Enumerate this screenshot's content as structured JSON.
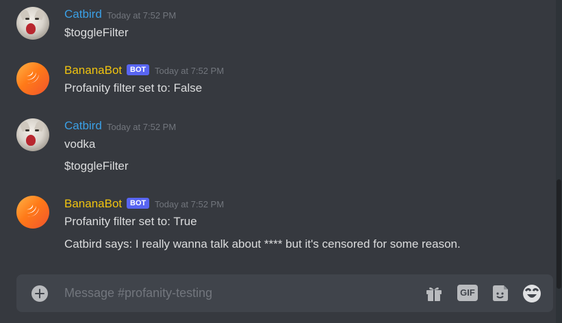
{
  "messages": [
    {
      "author": "Catbird",
      "is_bot": false,
      "timestamp": "Today at 7:52 PM",
      "lines": [
        "$toggleFilter"
      ]
    },
    {
      "author": "BananaBot",
      "is_bot": true,
      "badge": "BOT",
      "timestamp": "Today at 7:52 PM",
      "lines": [
        "Profanity filter set to: False"
      ]
    },
    {
      "author": "Catbird",
      "is_bot": false,
      "timestamp": "Today at 7:52 PM",
      "lines": [
        "vodka",
        "$toggleFilter"
      ]
    },
    {
      "author": "BananaBot",
      "is_bot": true,
      "badge": "BOT",
      "timestamp": "Today at 7:52 PM",
      "lines": [
        "Profanity filter set to: True",
        "Catbird says: I really wanna talk about **** but it's censored for some reason."
      ]
    }
  ],
  "composer": {
    "placeholder": "Message #profanity-testing",
    "gif_label": "GIF",
    "icons": [
      "add-icon",
      "gift-icon",
      "gif-icon",
      "sticker-icon",
      "emoji-icon"
    ]
  },
  "colors": {
    "background": "#36393f",
    "user_name": "#3ba0e6",
    "bot_name": "#f1c40f",
    "bot_badge": "#5865f2",
    "composer_bg": "#40444b"
  }
}
